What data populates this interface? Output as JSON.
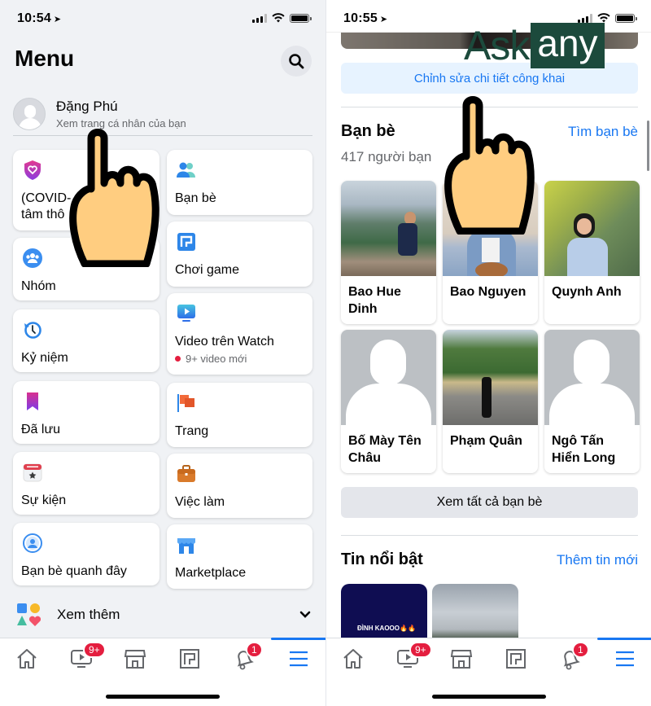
{
  "left": {
    "status_time": "10:54",
    "title": "Menu",
    "profile": {
      "name": "Đặng Phú",
      "subtitle": "Xem trang cá nhân của bạn"
    },
    "tiles": [
      {
        "label": "(COVID-19) Trung tâm thông tin",
        "visible_label": "(COVID-\ntâm thô",
        "icon": "covid-shield-icon"
      },
      {
        "label": "Bạn bè",
        "icon": "friends-icon"
      },
      {
        "label": "Nhóm",
        "icon": "groups-icon"
      },
      {
        "label": "Chơi game",
        "icon": "gaming-icon"
      },
      {
        "label": "Kỷ niệm",
        "icon": "memories-icon"
      },
      {
        "label": "Video trên Watch",
        "sub": "9+ video mới",
        "icon": "watch-icon"
      },
      {
        "label": "Đã lưu",
        "icon": "saved-icon"
      },
      {
        "label": "Trang",
        "icon": "pages-flag-icon"
      },
      {
        "label": "Sự kiện",
        "icon": "events-calendar-icon"
      },
      {
        "label": "Việc làm",
        "icon": "jobs-briefcase-icon"
      },
      {
        "label": "Bạn bè quanh đây",
        "icon": "nearby-friends-icon"
      },
      {
        "label": "Marketplace",
        "icon": "marketplace-icon"
      }
    ],
    "see_more": "Xem thêm"
  },
  "right": {
    "status_time": "10:55",
    "edit_button": "Chỉnh sửa chi tiết công khai",
    "friends": {
      "title": "Bạn bè",
      "find_link": "Tìm bạn bè",
      "count": "417 người bạn",
      "list": [
        {
          "name": "Bao Hue Dinh"
        },
        {
          "name": "Bao Nguyen"
        },
        {
          "name": "Quynh Anh"
        },
        {
          "name": "Bố Mày Tên Châu"
        },
        {
          "name": "Phạm Quân"
        },
        {
          "name": "Ngô Tấn Hiển Long"
        }
      ],
      "see_all": "Xem tất cả bạn bè"
    },
    "highlights": {
      "title": "Tin nổi bật",
      "add_link": "Thêm tin mới",
      "story_text": "ĐÌNH KAOOO🔥🔥"
    }
  },
  "tabbar": {
    "tabs": [
      {
        "name": "home",
        "icon": "home-icon"
      },
      {
        "name": "watch",
        "icon": "watch-tv-icon",
        "badge": "9+"
      },
      {
        "name": "marketplace",
        "icon": "marketplace-store-icon"
      },
      {
        "name": "gaming",
        "icon": "gaming-icon"
      },
      {
        "name": "notifications",
        "icon": "bell-icon",
        "badge": "1"
      },
      {
        "name": "menu",
        "icon": "hamburger-menu-icon",
        "active": true
      }
    ]
  },
  "watermark": {
    "part1": "Ask",
    "part2": "any"
  },
  "colors": {
    "accent": "#1877f2",
    "badge": "#e41e3f",
    "bg": "#f0f2f5",
    "watermark": "#1c4a3c"
  }
}
